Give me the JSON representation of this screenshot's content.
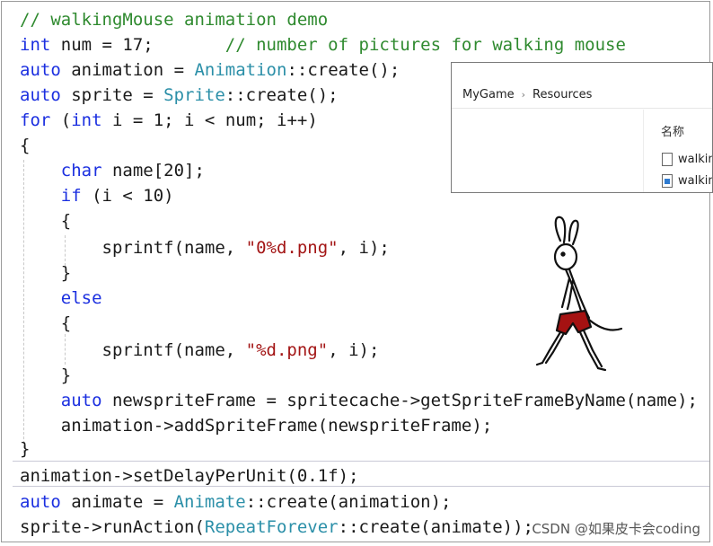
{
  "code": {
    "lines": [
      {
        "parts": [
          {
            "c": "cm",
            "t": "// walkingMouse animation demo"
          }
        ]
      },
      {
        "parts": [
          {
            "c": "kw",
            "t": "int"
          },
          {
            "c": "plain",
            "t": " num = 17;       "
          },
          {
            "c": "cm",
            "t": "// number of pictures for walking mouse"
          }
        ]
      },
      {
        "parts": [
          {
            "c": "kw",
            "t": "auto"
          },
          {
            "c": "plain",
            "t": " animation = "
          },
          {
            "c": "ty",
            "t": "Animation"
          },
          {
            "c": "plain",
            "t": "::create();"
          }
        ]
      },
      {
        "parts": [
          {
            "c": "kw",
            "t": "auto"
          },
          {
            "c": "plain",
            "t": " sprite = "
          },
          {
            "c": "ty",
            "t": "Sprite"
          },
          {
            "c": "plain",
            "t": "::create();"
          }
        ]
      },
      {
        "parts": [
          {
            "c": "kw",
            "t": "for"
          },
          {
            "c": "plain",
            "t": " ("
          },
          {
            "c": "kw",
            "t": "int"
          },
          {
            "c": "plain",
            "t": " i = 1; i < num; i++)"
          }
        ]
      },
      {
        "parts": [
          {
            "c": "plain",
            "t": "{"
          }
        ]
      },
      {
        "parts": [
          {
            "c": "plain",
            "t": "    "
          },
          {
            "c": "kw",
            "t": "char"
          },
          {
            "c": "plain",
            "t": " name[20];"
          }
        ]
      },
      {
        "parts": [
          {
            "c": "plain",
            "t": "    "
          },
          {
            "c": "kw",
            "t": "if"
          },
          {
            "c": "plain",
            "t": " (i < 10)"
          }
        ]
      },
      {
        "parts": [
          {
            "c": "plain",
            "t": "    {"
          }
        ]
      },
      {
        "parts": [
          {
            "c": "plain",
            "t": "        sprintf(name, "
          },
          {
            "c": "str",
            "t": "\"0%d.png\""
          },
          {
            "c": "plain",
            "t": ", i);"
          }
        ]
      },
      {
        "parts": [
          {
            "c": "plain",
            "t": "    }"
          }
        ]
      },
      {
        "parts": [
          {
            "c": "plain",
            "t": "    "
          },
          {
            "c": "kw",
            "t": "else"
          }
        ]
      },
      {
        "parts": [
          {
            "c": "plain",
            "t": "    {"
          }
        ]
      },
      {
        "parts": [
          {
            "c": "plain",
            "t": "        sprintf(name, "
          },
          {
            "c": "str",
            "t": "\"%d.png\""
          },
          {
            "c": "plain",
            "t": ", i);"
          }
        ]
      },
      {
        "parts": [
          {
            "c": "plain",
            "t": "    }"
          }
        ]
      },
      {
        "parts": [
          {
            "c": "plain",
            "t": "    "
          },
          {
            "c": "kw",
            "t": "auto"
          },
          {
            "c": "plain",
            "t": " newspriteFrame = spritecache->getSpriteFrameByName(name);"
          }
        ]
      },
      {
        "parts": [
          {
            "c": "plain",
            "t": "    animation->addSpriteFrame(newspriteFrame);"
          }
        ]
      },
      {
        "parts": [
          {
            "c": "plain",
            "t": "}"
          }
        ]
      },
      {
        "parts": [
          {
            "c": "plain",
            "t": "animation->setDelayPerUnit(0.1f);"
          }
        ]
      },
      {
        "parts": [
          {
            "c": "kw",
            "t": "auto"
          },
          {
            "c": "plain",
            "t": " animate = "
          },
          {
            "c": "ty",
            "t": "Animate"
          },
          {
            "c": "plain",
            "t": "::create(animation);"
          }
        ]
      },
      {
        "parts": [
          {
            "c": "plain",
            "t": "sprite->runAction("
          },
          {
            "c": "ty",
            "t": "RepeatForever"
          },
          {
            "c": "plain",
            "t": "::create(animate));"
          }
        ]
      }
    ]
  },
  "explorer": {
    "breadcrumb": [
      "MyGame",
      "Resources"
    ],
    "column_header": "名称",
    "files": [
      {
        "name": "walkin",
        "icon": "document-icon"
      },
      {
        "name": "walkin",
        "icon": "image-file-icon"
      }
    ]
  },
  "watermark": "CSDN @如果皮卡会coding",
  "colors": {
    "keyword": "#1b2fe0",
    "type": "#2b8fa8",
    "string": "#a31515",
    "comment": "#2f8a2f"
  }
}
